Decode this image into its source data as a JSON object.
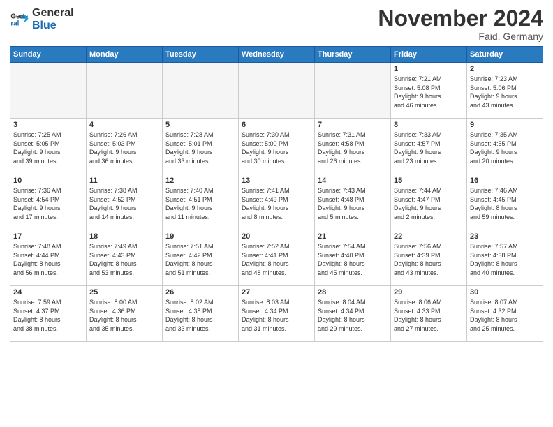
{
  "header": {
    "logo_line1": "General",
    "logo_line2": "Blue",
    "title": "November 2024",
    "location": "Faid, Germany"
  },
  "weekdays": [
    "Sunday",
    "Monday",
    "Tuesday",
    "Wednesday",
    "Thursday",
    "Friday",
    "Saturday"
  ],
  "weeks": [
    [
      {
        "day": "",
        "info": ""
      },
      {
        "day": "",
        "info": ""
      },
      {
        "day": "",
        "info": ""
      },
      {
        "day": "",
        "info": ""
      },
      {
        "day": "",
        "info": ""
      },
      {
        "day": "1",
        "info": "Sunrise: 7:21 AM\nSunset: 5:08 PM\nDaylight: 9 hours\nand 46 minutes."
      },
      {
        "day": "2",
        "info": "Sunrise: 7:23 AM\nSunset: 5:06 PM\nDaylight: 9 hours\nand 43 minutes."
      }
    ],
    [
      {
        "day": "3",
        "info": "Sunrise: 7:25 AM\nSunset: 5:05 PM\nDaylight: 9 hours\nand 39 minutes."
      },
      {
        "day": "4",
        "info": "Sunrise: 7:26 AM\nSunset: 5:03 PM\nDaylight: 9 hours\nand 36 minutes."
      },
      {
        "day": "5",
        "info": "Sunrise: 7:28 AM\nSunset: 5:01 PM\nDaylight: 9 hours\nand 33 minutes."
      },
      {
        "day": "6",
        "info": "Sunrise: 7:30 AM\nSunset: 5:00 PM\nDaylight: 9 hours\nand 30 minutes."
      },
      {
        "day": "7",
        "info": "Sunrise: 7:31 AM\nSunset: 4:58 PM\nDaylight: 9 hours\nand 26 minutes."
      },
      {
        "day": "8",
        "info": "Sunrise: 7:33 AM\nSunset: 4:57 PM\nDaylight: 9 hours\nand 23 minutes."
      },
      {
        "day": "9",
        "info": "Sunrise: 7:35 AM\nSunset: 4:55 PM\nDaylight: 9 hours\nand 20 minutes."
      }
    ],
    [
      {
        "day": "10",
        "info": "Sunrise: 7:36 AM\nSunset: 4:54 PM\nDaylight: 9 hours\nand 17 minutes."
      },
      {
        "day": "11",
        "info": "Sunrise: 7:38 AM\nSunset: 4:52 PM\nDaylight: 9 hours\nand 14 minutes."
      },
      {
        "day": "12",
        "info": "Sunrise: 7:40 AM\nSunset: 4:51 PM\nDaylight: 9 hours\nand 11 minutes."
      },
      {
        "day": "13",
        "info": "Sunrise: 7:41 AM\nSunset: 4:49 PM\nDaylight: 9 hours\nand 8 minutes."
      },
      {
        "day": "14",
        "info": "Sunrise: 7:43 AM\nSunset: 4:48 PM\nDaylight: 9 hours\nand 5 minutes."
      },
      {
        "day": "15",
        "info": "Sunrise: 7:44 AM\nSunset: 4:47 PM\nDaylight: 9 hours\nand 2 minutes."
      },
      {
        "day": "16",
        "info": "Sunrise: 7:46 AM\nSunset: 4:45 PM\nDaylight: 8 hours\nand 59 minutes."
      }
    ],
    [
      {
        "day": "17",
        "info": "Sunrise: 7:48 AM\nSunset: 4:44 PM\nDaylight: 8 hours\nand 56 minutes."
      },
      {
        "day": "18",
        "info": "Sunrise: 7:49 AM\nSunset: 4:43 PM\nDaylight: 8 hours\nand 53 minutes."
      },
      {
        "day": "19",
        "info": "Sunrise: 7:51 AM\nSunset: 4:42 PM\nDaylight: 8 hours\nand 51 minutes."
      },
      {
        "day": "20",
        "info": "Sunrise: 7:52 AM\nSunset: 4:41 PM\nDaylight: 8 hours\nand 48 minutes."
      },
      {
        "day": "21",
        "info": "Sunrise: 7:54 AM\nSunset: 4:40 PM\nDaylight: 8 hours\nand 45 minutes."
      },
      {
        "day": "22",
        "info": "Sunrise: 7:56 AM\nSunset: 4:39 PM\nDaylight: 8 hours\nand 43 minutes."
      },
      {
        "day": "23",
        "info": "Sunrise: 7:57 AM\nSunset: 4:38 PM\nDaylight: 8 hours\nand 40 minutes."
      }
    ],
    [
      {
        "day": "24",
        "info": "Sunrise: 7:59 AM\nSunset: 4:37 PM\nDaylight: 8 hours\nand 38 minutes."
      },
      {
        "day": "25",
        "info": "Sunrise: 8:00 AM\nSunset: 4:36 PM\nDaylight: 8 hours\nand 35 minutes."
      },
      {
        "day": "26",
        "info": "Sunrise: 8:02 AM\nSunset: 4:35 PM\nDaylight: 8 hours\nand 33 minutes."
      },
      {
        "day": "27",
        "info": "Sunrise: 8:03 AM\nSunset: 4:34 PM\nDaylight: 8 hours\nand 31 minutes."
      },
      {
        "day": "28",
        "info": "Sunrise: 8:04 AM\nSunset: 4:34 PM\nDaylight: 8 hours\nand 29 minutes."
      },
      {
        "day": "29",
        "info": "Sunrise: 8:06 AM\nSunset: 4:33 PM\nDaylight: 8 hours\nand 27 minutes."
      },
      {
        "day": "30",
        "info": "Sunrise: 8:07 AM\nSunset: 4:32 PM\nDaylight: 8 hours\nand 25 minutes."
      }
    ]
  ]
}
